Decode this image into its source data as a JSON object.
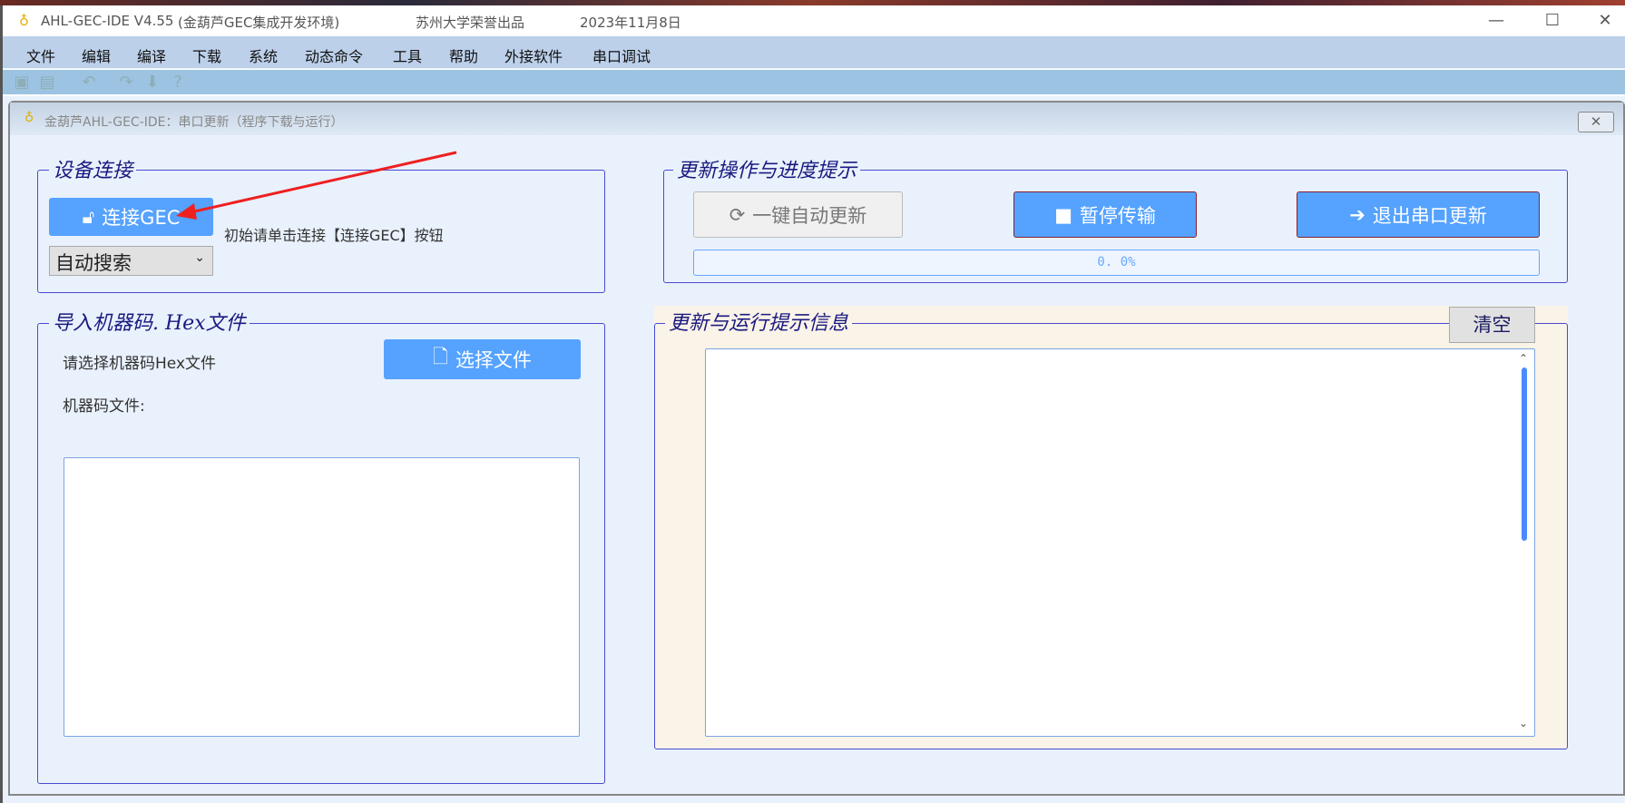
{
  "window": {
    "title": "AHL-GEC-IDE V4.55",
    "subtitle": "(金葫芦GEC集成开发环境)",
    "publisher": "苏州大学荣誉出品",
    "date": "2023年11月8日"
  },
  "menu": [
    "文件",
    "编辑",
    "编译",
    "下载",
    "系统",
    "动态命令",
    "工具",
    "帮助",
    "外接软件",
    "串口调试"
  ],
  "toolbar": [
    "save-icon",
    "save-all-icon",
    "undo-icon",
    "redo-icon",
    "download-icon",
    "help-icon"
  ],
  "child": {
    "title": "金葫芦AHL-GEC-IDE：串口更新（程序下载与运行）",
    "close": "✕"
  },
  "device": {
    "legend": "设备连接",
    "connect": "连接GEC",
    "hint": "初始请单击连接【连接GEC】按钮",
    "port": "自动搜索"
  },
  "hex": {
    "legend": "导入机器码. Hex文件",
    "prompt": "请选择机器码Hex文件",
    "file_label": "机器码文件:",
    "select": "选择文件",
    "content": ""
  },
  "update": {
    "legend": "更新操作与进度提示",
    "auto": "一键自动更新",
    "pause": "暂停传输",
    "exit": "退出串口更新",
    "progress": 0.0,
    "progress_text": "0. 0%"
  },
  "log": {
    "legend": "更新与运行提示信息",
    "clear": "清空",
    "content": ""
  },
  "colors": {
    "button": "#55a2ff",
    "legend": "#1a1a80",
    "annotation_arrow": "#ee2020"
  }
}
